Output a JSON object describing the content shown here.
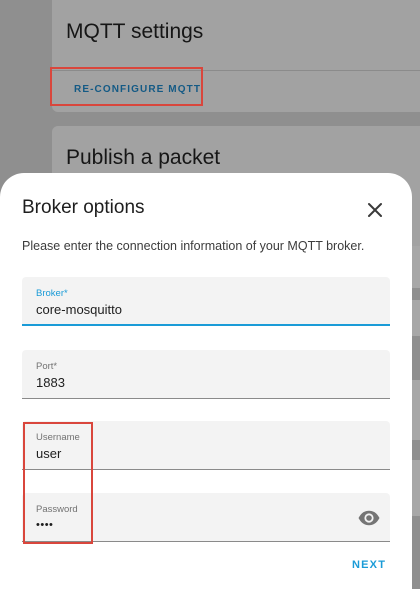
{
  "background": {
    "mqtt_card": {
      "title": "MQTT settings",
      "reconfigure_label": "RE-CONFIGURE MQTT"
    },
    "publish_card": {
      "title": "Publish a packet"
    }
  },
  "dialog": {
    "title": "Broker options",
    "description": "Please enter the connection information of your MQTT broker.",
    "fields": {
      "broker": {
        "label": "Broker*",
        "value": "core-mosquitto"
      },
      "port": {
        "label": "Port*",
        "value": "1883"
      },
      "username": {
        "label": "Username",
        "value": "user"
      },
      "password": {
        "label": "Password",
        "value": "••••"
      }
    },
    "next_label": "NEXT"
  },
  "colors": {
    "accent": "#1a9bd7",
    "highlight": "#d9463c",
    "link": "#145a85"
  },
  "icons": {
    "close": "close-icon",
    "password_visibility": "eye-icon"
  }
}
